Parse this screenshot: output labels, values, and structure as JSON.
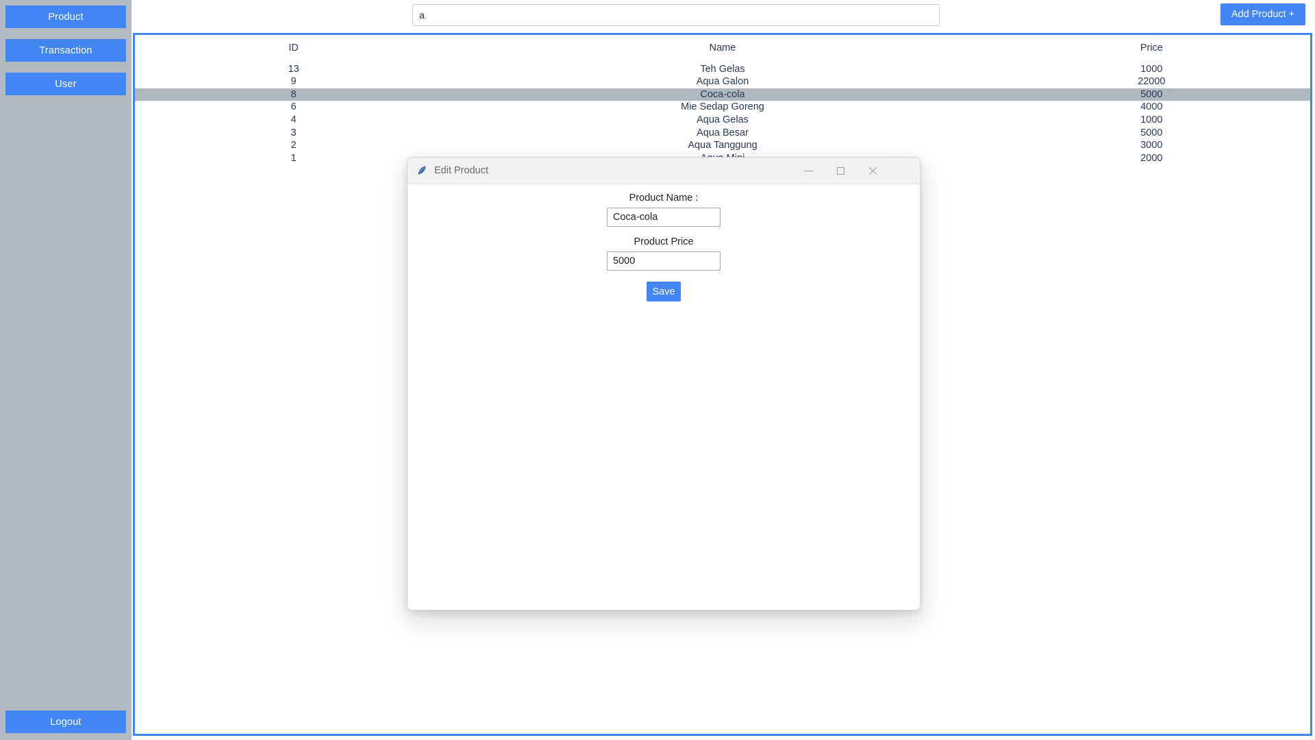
{
  "sidebar": {
    "items": [
      {
        "label": "Product",
        "name": "sidebar-item-product"
      },
      {
        "label": "Transaction",
        "name": "sidebar-item-transaction"
      },
      {
        "label": "User",
        "name": "sidebar-item-user"
      }
    ],
    "logout_label": "Logout",
    "background_color": "#b2b9c0",
    "button_color": "#4285f4"
  },
  "toolbar": {
    "search_value": "a",
    "search_placeholder": "",
    "add_product_label": "Add Product +"
  },
  "table": {
    "columns": [
      "ID",
      "Name",
      "Price"
    ],
    "selected_row_index": 2,
    "selected_row_color": "#b0b7bf",
    "rows": [
      {
        "id": "13",
        "name": "Teh Gelas",
        "price": "1000"
      },
      {
        "id": "9",
        "name": "Aqua Galon",
        "price": "22000"
      },
      {
        "id": "8",
        "name": "Coca-cola",
        "price": "5000"
      },
      {
        "id": "6",
        "name": "Mie Sedap Goreng",
        "price": "4000"
      },
      {
        "id": "4",
        "name": "Aqua Gelas",
        "price": "1000"
      },
      {
        "id": "3",
        "name": "Aqua Besar",
        "price": "5000"
      },
      {
        "id": "2",
        "name": "Aqua Tanggung",
        "price": "3000"
      },
      {
        "id": "1",
        "name": "Aqua Mini",
        "price": "2000"
      }
    ]
  },
  "dialog": {
    "title": "Edit Product",
    "icon": "feather-icon",
    "controls": {
      "minimize": "minimize-icon",
      "maximize": "maximize-icon",
      "close": "close-icon"
    },
    "product_name_label": "Product Name :",
    "product_name_value": "Coca-cola",
    "product_price_label": "Product Price",
    "product_price_value": "5000",
    "save_label": "Save"
  }
}
